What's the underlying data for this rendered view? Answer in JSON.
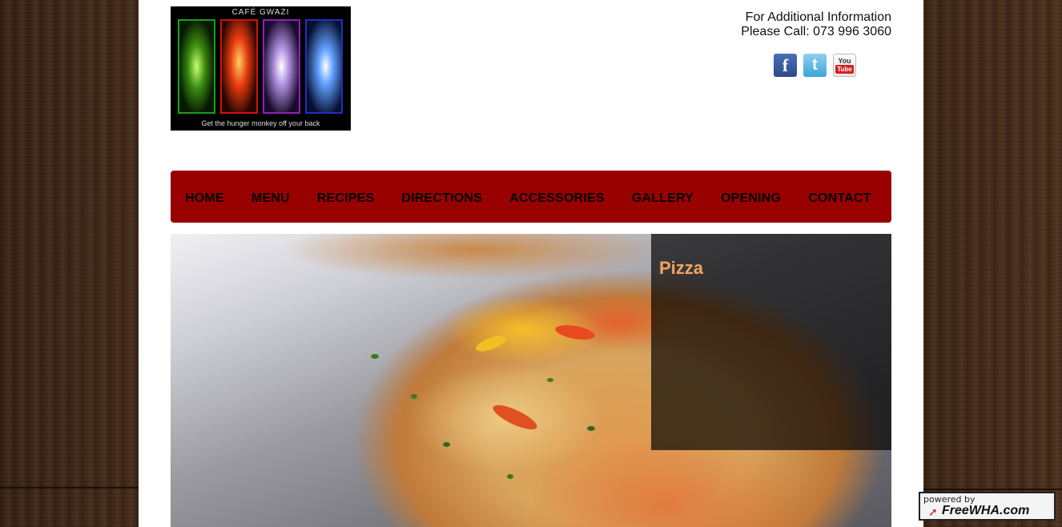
{
  "logo": {
    "title": "CAFÉ GWAZI",
    "tagline": "Get the hunger monkey off your back"
  },
  "contact": {
    "line1": "For Additional Information",
    "line2": "Please Call: 073 996 3060"
  },
  "social": {
    "facebook": "f",
    "twitter": "t",
    "youtube_you": "You",
    "youtube_tube": "Tube"
  },
  "nav": {
    "items": [
      {
        "label": "HOME"
      },
      {
        "label": "MENU"
      },
      {
        "label": "RECIPES"
      },
      {
        "label": "DIRECTIONS"
      },
      {
        "label": "ACCESSORIES"
      },
      {
        "label": "GALLERY"
      },
      {
        "label": "OPENING"
      },
      {
        "label": "CONTACT"
      }
    ]
  },
  "slider": {
    "caption_title": "Pizza"
  },
  "badge": {
    "powered_by": "powered by",
    "brand": "FreeWHA.com"
  },
  "colors": {
    "nav_background": "#990000",
    "caption_title": "#f5a55a",
    "page_background": "#ffffff"
  }
}
